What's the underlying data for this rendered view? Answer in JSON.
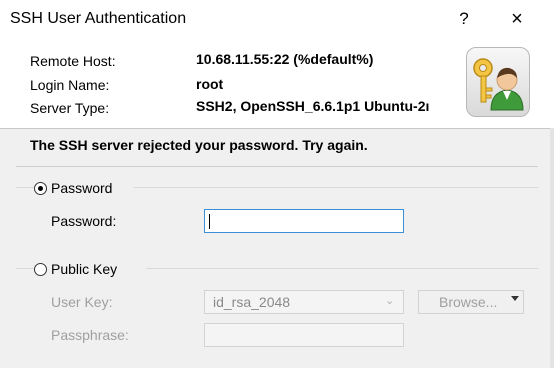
{
  "window": {
    "title": "SSH User Authentication",
    "help_glyph": "?",
    "close_glyph": "×"
  },
  "header": {
    "remote_host_label": "Remote Host:",
    "remote_host_value": "10.68.11.55:22 (%default%)",
    "login_name_label": "Login Name:",
    "login_name_value": "root",
    "server_type_label": "Server Type:",
    "server_type_value": "SSH2, OpenSSH_6.6.1p1 Ubuntu-2ı",
    "icon": "key-user-icon"
  },
  "message": "The SSH server rejected your password. Try again.",
  "password_group": {
    "radio_label": "Password",
    "selected": true,
    "field_label": "Password:",
    "field_value": ""
  },
  "publickey_group": {
    "radio_label": "Public Key",
    "selected": false,
    "user_key_label": "User Key:",
    "user_key_value": "id_rsa_2048",
    "browse_label": "Browse...",
    "passphrase_label": "Passphrase:",
    "passphrase_value": ""
  },
  "colors": {
    "focus_border": "#3c8fd6",
    "disabled_text": "#a0a0a0"
  }
}
